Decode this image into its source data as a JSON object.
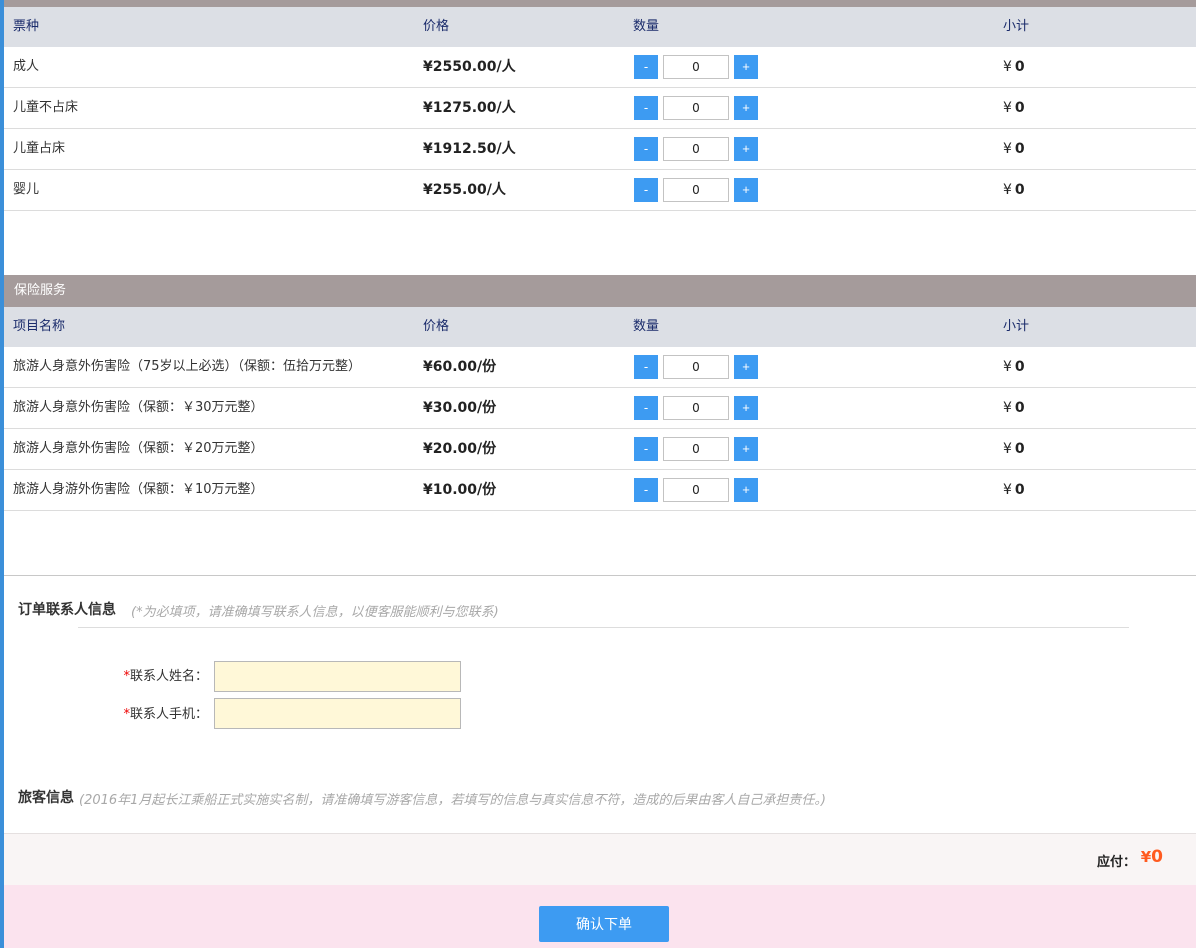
{
  "tickets": {
    "headers": [
      "票种",
      "价格",
      "数量",
      "小计"
    ],
    "rows": [
      {
        "name": "成人",
        "price": "¥2550.00/人",
        "qty": "0",
        "subtotal": "0"
      },
      {
        "name": "儿童不占床",
        "price": "¥1275.00/人",
        "qty": "0",
        "subtotal": "0"
      },
      {
        "name": "儿童占床",
        "price": "¥1912.50/人",
        "qty": "0",
        "subtotal": "0"
      },
      {
        "name": "婴儿",
        "price": "¥255.00/人",
        "qty": "0",
        "subtotal": "0"
      }
    ]
  },
  "insurance": {
    "section_title": "保险服务",
    "headers": [
      "项目名称",
      "价格",
      "数量",
      "小计"
    ],
    "rows": [
      {
        "name": "旅游人身意外伤害险（75岁以上必选）（保额：伍拾万元整）",
        "price": "¥60.00/份",
        "qty": "0",
        "subtotal": "0"
      },
      {
        "name": "旅游人身意外伤害险（保额：￥30万元整）",
        "price": "¥30.00/份",
        "qty": "0",
        "subtotal": "0"
      },
      {
        "name": "旅游人身意外伤害险（保额：￥20万元整）",
        "price": "¥20.00/份",
        "qty": "0",
        "subtotal": "0"
      },
      {
        "name": "旅游人身游外伤害险（保额：￥10万元整）",
        "price": "¥10.00/份",
        "qty": "0",
        "subtotal": "0"
      }
    ]
  },
  "qty_controls": {
    "minus": "-",
    "plus": "+"
  },
  "currency_symbol": "¥",
  "contact": {
    "title": "订单联系人信息",
    "note": "(*为必填项，请准确填写联系人信息，以便客服能顺利与您联系)",
    "required_mark": "*",
    "name_label": "联系人姓名：",
    "phone_label": "联系人手机：",
    "name_value": "",
    "phone_value": ""
  },
  "traveler": {
    "title": "旅客信息",
    "note": "(2016年1月起长江乘船正式实施实名制，请准确填写游客信息，若填写的信息与真实信息不符，造成的后果由客人自己承担责任。)"
  },
  "total": {
    "label": "应付：",
    "symbol": "¥",
    "value": "0"
  },
  "submit_label": "确认下单",
  "colors": {
    "accent": "#3d9bf2",
    "header_bar": "#a59b9b",
    "total": "#ff5a1f",
    "input_bg": "#fff8d8"
  }
}
